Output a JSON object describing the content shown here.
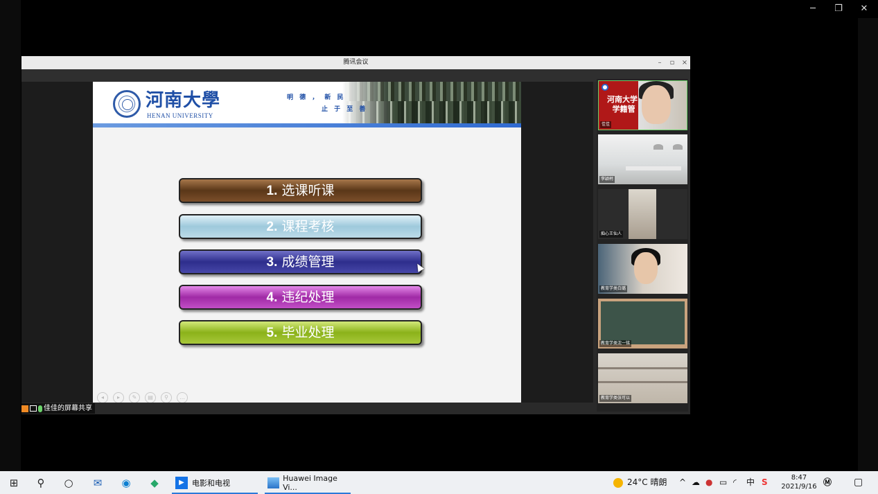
{
  "meeting": {
    "title": "腾讯会议",
    "share_label": "佳佳的屏幕共享"
  },
  "slide": {
    "university_cn": "河南大學",
    "university_en": "HENAN UNIVERSITY",
    "motto_line1": "明 德 ， 新 民",
    "motto_line2": "止 于 至 善",
    "menu": [
      {
        "num": "1.",
        "label": "选课听课"
      },
      {
        "num": "2.",
        "label": "课程考核"
      },
      {
        "num": "3.",
        "label": "成绩管理"
      },
      {
        "num": "4.",
        "label": "违纪处理"
      },
      {
        "num": "5.",
        "label": "毕业处理"
      }
    ]
  },
  "participants": [
    {
      "name": "佳佳",
      "bg_text": "河南大学\n学籍管"
    },
    {
      "name": "李颖柯"
    },
    {
      "name": "痴心王仙人"
    },
    {
      "name": "教育学类白璐"
    },
    {
      "name": "教育学类沈一铭"
    },
    {
      "name": "教育学类张可以"
    }
  ],
  "taskbar": {
    "apps": [
      {
        "label": "电影和电视"
      },
      {
        "label": "Huawei Image Vi..."
      }
    ],
    "weather": "24°C 晴朗",
    "ime": "中",
    "time": "8:47",
    "date": "2021/9/16"
  },
  "colors": {
    "active_speaker_border": "#6bd26b",
    "taskbar_bg": "#eef0f3",
    "brand_blue": "#1f4fa6"
  }
}
